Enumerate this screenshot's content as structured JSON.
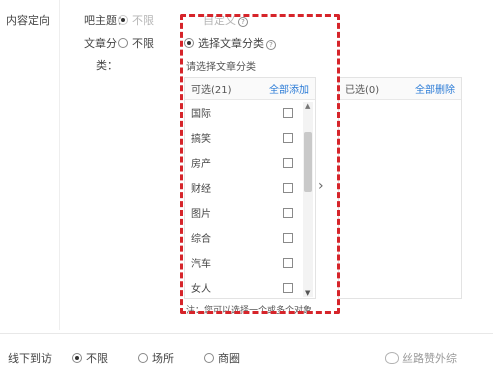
{
  "section": {
    "label": "内容定向"
  },
  "row1": {
    "label": "吧主题：",
    "option_unlimited": "不限",
    "option_custom": "自定义"
  },
  "row2": {
    "label_line1": "文章分",
    "label_line2": "类：",
    "option_unlimited": "不限",
    "option_select": "选择文章分类"
  },
  "hint": "请选择文章分类",
  "available": {
    "title": "可选(21)",
    "action": "全部添加",
    "items": [
      "国际",
      "搞笑",
      "房产",
      "财经",
      "图片",
      "综合",
      "汽车",
      "女人"
    ]
  },
  "selected": {
    "title": "已选(0)",
    "action": "全部删除"
  },
  "note": "注：您可以选择一个或多个对象",
  "bottom": {
    "label": "线下到访",
    "options": [
      "不限",
      "场所",
      "商圈"
    ],
    "selected_index": 0
  },
  "watermark": "丝路赞外综",
  "icons": {
    "help": "question-circle-icon",
    "transfer": "chevron-right-icon",
    "scroll_up": "scroll-up-icon",
    "scroll_down": "scroll-down-icon"
  },
  "colors": {
    "highlight": "#d6242a",
    "link": "#2b7bd6"
  }
}
